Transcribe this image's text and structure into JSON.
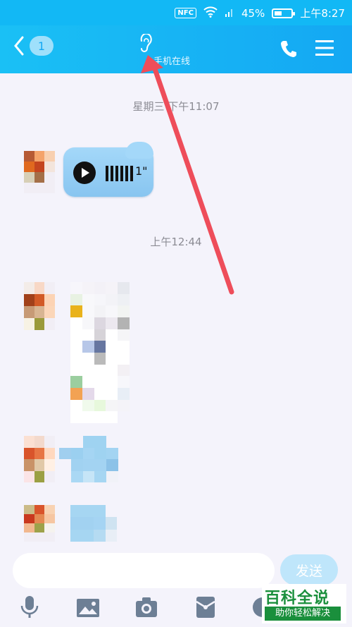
{
  "status_bar": {
    "nfc": "NFC",
    "battery_percent": "45%",
    "battery_level": 0.45,
    "time": "上午8:27"
  },
  "header": {
    "back_badge": "1",
    "subtitle": "手机在线"
  },
  "messages": [
    {
      "time": "星期三 下午11:07",
      "type": "voice",
      "duration": "1\""
    },
    {
      "time": "上午12:44",
      "type": "images"
    }
  ],
  "input": {
    "placeholder": "",
    "send_label": "发送"
  },
  "toolbar": [
    "microphone-icon",
    "image-icon",
    "camera-icon",
    "red-packet-icon",
    "emoji-icon"
  ],
  "watermark": {
    "main": "百科全说",
    "sub": "助你轻松解决"
  },
  "colors": {
    "header": "#14a8f3",
    "bubble": "#a4d8f9",
    "arrow": "#ee4d5a",
    "watermark": "#1a8f3c"
  }
}
